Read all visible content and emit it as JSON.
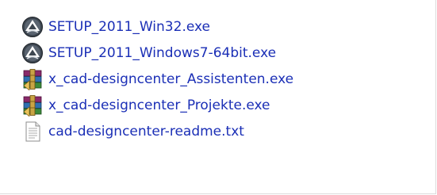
{
  "files": [
    {
      "name": "SETUP_2011_Win32.exe",
      "icon": "setup-app-icon"
    },
    {
      "name": "SETUP_2011_Windows7-64bit.exe",
      "icon": "setup-app-icon"
    },
    {
      "name": "x_cad-designcenter_Assistenten.exe",
      "icon": "winrar-archive-icon"
    },
    {
      "name": "x_cad-designcenter_Projekte.exe",
      "icon": "winrar-archive-icon"
    },
    {
      "name": "cad-designcenter-readme.txt",
      "icon": "text-file-icon"
    }
  ],
  "colors": {
    "label": "#1b2fb6",
    "background": "#ffffff"
  }
}
